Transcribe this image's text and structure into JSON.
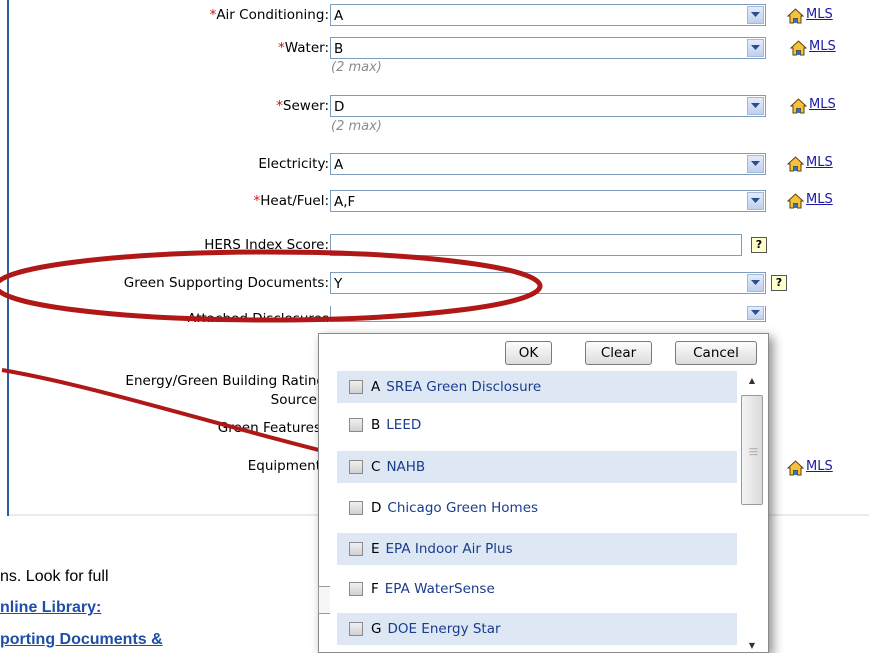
{
  "form": {
    "fields": [
      {
        "label": "Air Conditioning:",
        "required": "*",
        "value": "A",
        "mls": "MLS"
      },
      {
        "label": "Water:",
        "required": "*",
        "value": "B",
        "hint": "(2 max)",
        "mls": "MLS"
      },
      {
        "label": "Sewer:",
        "required": "*",
        "value": "D",
        "hint": "(2 max)",
        "mls": "MLS"
      },
      {
        "label": "Electricity:",
        "value": "A",
        "mls": "MLS"
      },
      {
        "label": "Heat/Fuel:",
        "required": "*",
        "value": "A,F",
        "mls": "MLS"
      },
      {
        "label": "HERS Index Score:",
        "value": "",
        "help": "?"
      },
      {
        "label": "Green Supporting Documents:",
        "value": "Y",
        "help": "?"
      },
      {
        "label": "Attached Disclosures"
      },
      {
        "label": "Energy/Green Building Rating"
      },
      {
        "label": "Source"
      },
      {
        "label": "Green Features"
      },
      {
        "label": "Equipment",
        "mls": "MLS"
      }
    ]
  },
  "popup": {
    "ok_label": "OK",
    "clear_label": "Clear",
    "cancel_label": "Cancel",
    "options": [
      {
        "code": "A",
        "text": "SREA Green Disclosure"
      },
      {
        "code": "B",
        "text": "LEED"
      },
      {
        "code": "C",
        "text": "NAHB"
      },
      {
        "code": "D",
        "text": "Chicago Green Homes"
      },
      {
        "code": "E",
        "text": "EPA Indoor Air Plus"
      },
      {
        "code": "F",
        "text": "EPA WaterSense"
      },
      {
        "code": "G",
        "text": "DOE Energy Star"
      }
    ]
  },
  "document": {
    "line1": "ns.  Look for full",
    "line2": "nline Library:",
    "line3": "porting Documents &"
  },
  "colors": {
    "annotation_red": "#b01818",
    "required_red": "#d01010",
    "link_blue": "#1a1aa6",
    "option_stripe": "#dde8f4",
    "panel_border": "#2e5e9e"
  },
  "icons": {
    "mls": "house-icon",
    "dropdown": "chevron-down-icon",
    "help": "question-icon"
  }
}
